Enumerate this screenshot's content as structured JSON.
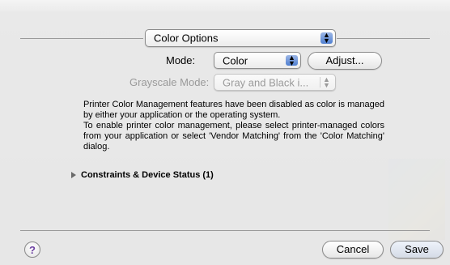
{
  "sheet": {
    "panel_popup": {
      "value": "Color Options"
    },
    "mode": {
      "label": "Mode:",
      "value": "Color",
      "adjust_button": "Adjust..."
    },
    "grayscale_mode": {
      "label": "Grayscale Mode:",
      "value": "Gray and Black i..."
    },
    "message": {
      "paragraph1": "Printer Color Management features have been disabled as color is managed by either your application or the operating system.",
      "paragraph2": "To enable printer color management, please select printer-managed colors from your application or select 'Vendor Matching' from the 'Color Matching' dialog."
    },
    "constraints": {
      "label": "Constraints & Device Status (1)"
    },
    "buttons": {
      "help": "?",
      "cancel": "Cancel",
      "save": "Save"
    }
  },
  "colors": {
    "popup_arrows": "#4f7fd1",
    "help_glyph": "#6b3fa0"
  }
}
